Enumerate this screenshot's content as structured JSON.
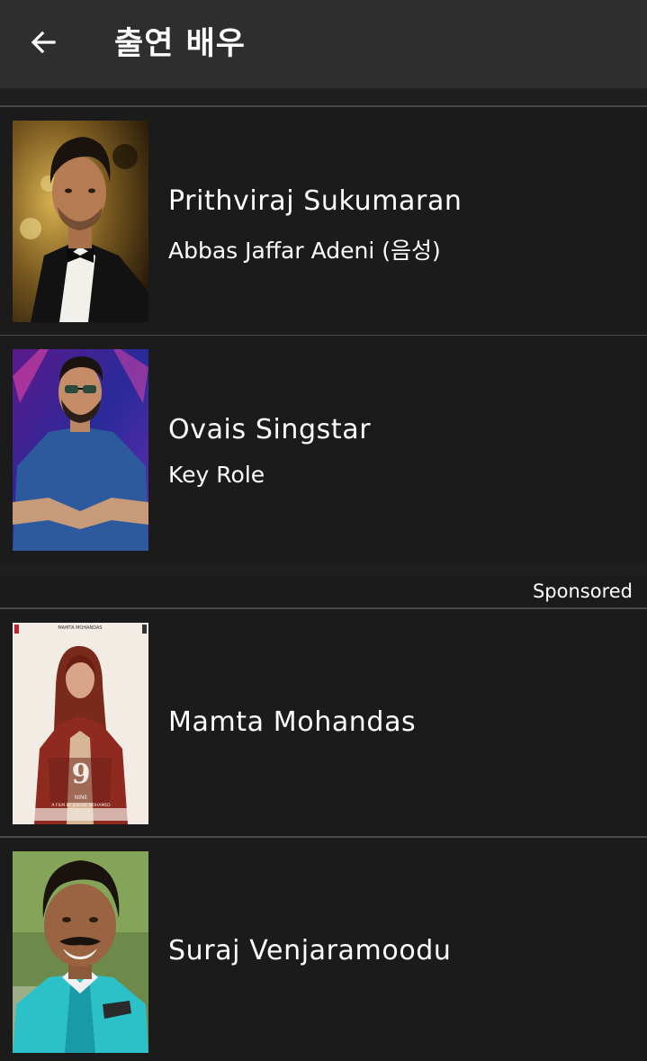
{
  "header": {
    "title": "출연 배우",
    "back_icon": "arrow-left-icon"
  },
  "cast": [
    {
      "name": "Prithviraj Sukumaran",
      "role": "Abbas Jaffar Adeni (음성)"
    },
    {
      "name": "Ovais Singstar",
      "role": "Key Role"
    }
  ],
  "sponsored": {
    "label": "Sponsored",
    "items": [
      {
        "name": "Mamta Mohandas"
      },
      {
        "name": "Suraj Venjaramoodu"
      }
    ]
  },
  "poster_text": {
    "top": "MAMTA MOHANDAS",
    "number": "9",
    "title": "NINE",
    "credit": "A FILM BY JENUSE MOHAMED"
  }
}
